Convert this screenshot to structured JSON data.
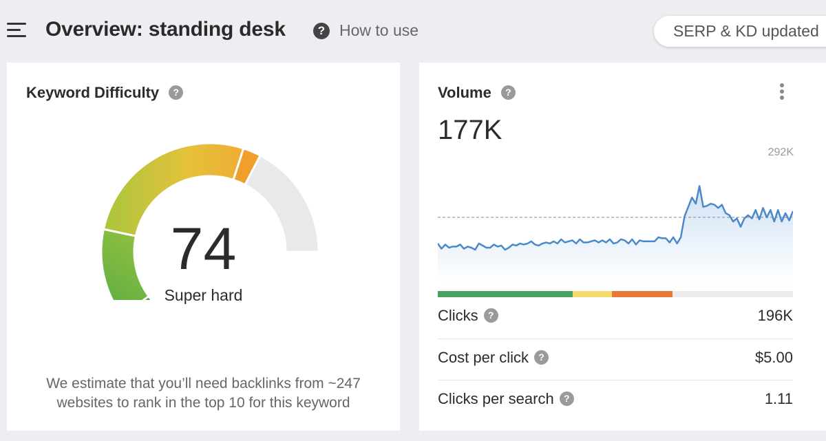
{
  "header": {
    "title": "Overview: standing desk",
    "help_icon": "question-circle-icon",
    "how_to_use_label": "How to use",
    "serp_button_label": "SERP & KD updated"
  },
  "keyword_difficulty": {
    "title": "Keyword Difficulty",
    "value": "74",
    "label": "Super hard",
    "score": 74,
    "note": "We estimate that you’ll need backlinks from ~247 websites to rank in the top 10 for this keyword",
    "colors": {
      "easy": "#3a9a5b",
      "medium": "#9cc13e",
      "hard": "#f0b43c",
      "super_hard": "#f0a02a",
      "empty": "#e9e9eb"
    }
  },
  "volume": {
    "title": "Volume",
    "value": "177K",
    "max_label": "292K",
    "trend": [
      0.31,
      0.26,
      0.3,
      0.27,
      0.28,
      0.28,
      0.3,
      0.26,
      0.28,
      0.27,
      0.25,
      0.31,
      0.29,
      0.27,
      0.27,
      0.3,
      0.28,
      0.29,
      0.25,
      0.27,
      0.3,
      0.29,
      0.31,
      0.3,
      0.31,
      0.33,
      0.3,
      0.29,
      0.31,
      0.32,
      0.31,
      0.33,
      0.31,
      0.35,
      0.32,
      0.33,
      0.34,
      0.31,
      0.35,
      0.32,
      0.32,
      0.33,
      0.34,
      0.32,
      0.34,
      0.32,
      0.35,
      0.31,
      0.32,
      0.35,
      0.34,
      0.31,
      0.35,
      0.3,
      0.34,
      0.33,
      0.33,
      0.33,
      0.33,
      0.37,
      0.36,
      0.36,
      0.32,
      0.37,
      0.31,
      0.37,
      0.57,
      0.66,
      0.75,
      0.69,
      0.86,
      0.66,
      0.67,
      0.69,
      0.68,
      0.65,
      0.68,
      0.6,
      0.58,
      0.52,
      0.55,
      0.47,
      0.55,
      0.58,
      0.55,
      0.63,
      0.54,
      0.65,
      0.56,
      0.63,
      0.52,
      0.63,
      0.52,
      0.6,
      0.53,
      0.62
    ],
    "average_line": 0.56,
    "colors": {
      "line": "#4a88c9",
      "fill_top": "#cfe0f3",
      "fill_bottom": "#ffffff",
      "avg_line": "#888888"
    },
    "click_distribution": [
      {
        "color": "#4aa15f",
        "share": 0.38
      },
      {
        "color": "#f3dc6b",
        "share": 0.11
      },
      {
        "color": "#e8773a",
        "share": 0.17
      },
      {
        "color": "#ececef",
        "share": 0.34
      }
    ],
    "metrics": {
      "clicks_label": "Clicks",
      "clicks_value": "196K",
      "cpc_label": "Cost per click",
      "cpc_value": "$5.00",
      "cps_label": "Clicks per search",
      "cps_value": "1.11"
    }
  }
}
